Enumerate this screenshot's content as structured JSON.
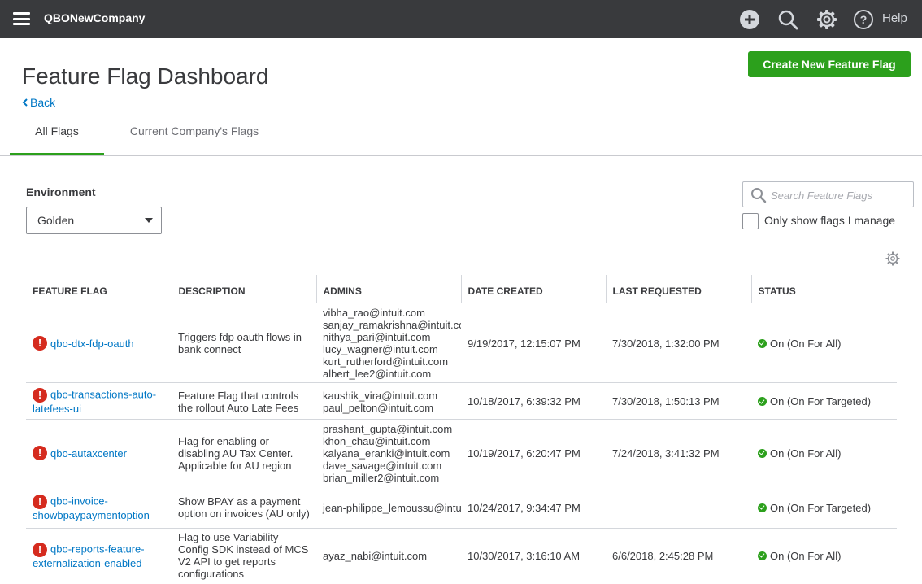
{
  "topbar": {
    "company_name": "QBONewCompany",
    "help_label": "Help",
    "icons": [
      "menu-icon",
      "plus-icon",
      "search-icon",
      "gear-icon",
      "help-icon"
    ]
  },
  "page": {
    "title": "Feature Flag Dashboard",
    "back_label": "Back",
    "create_button_label": "Create New Feature Flag"
  },
  "tabs": [
    {
      "label": "All Flags",
      "active": true
    },
    {
      "label": "Current Company's Flags",
      "active": false
    }
  ],
  "filters": {
    "environment_label": "Environment",
    "environment_value": "Golden",
    "search_placeholder": "Search Feature Flags",
    "manage_checkbox_label": "Only show flags I manage",
    "manage_checked": false
  },
  "table": {
    "headers": [
      "FEATURE FLAG",
      "DESCRIPTION",
      "ADMINS",
      "DATE CREATED",
      "LAST REQUESTED",
      "STATUS"
    ],
    "rows": [
      {
        "flag_line1": "qbo-dtx-fdp-oauth",
        "flag_line2": "",
        "description": "Triggers fdp oauth flows in bank connect",
        "admins": [
          "vibha_rao@intuit.com",
          "sanjay_ramakrishna@intuit.com",
          "nithya_pari@intuit.com",
          "lucy_wagner@intuit.com",
          "kurt_rutherford@intuit.com",
          "albert_lee2@intuit.com"
        ],
        "date_created": "9/19/2017, 12:15:07 PM",
        "last_requested": "7/30/2018, 1:32:00 PM",
        "status": "On (On For All)"
      },
      {
        "flag_line1": "qbo-transactions-auto-",
        "flag_line2": "latefees-ui",
        "description": "Feature Flag that controls the rollout Auto Late Fees",
        "admins": [
          "kaushik_vira@intuit.com",
          "paul_pelton@intuit.com"
        ],
        "date_created": "10/18/2017, 6:39:32 PM",
        "last_requested": "7/30/2018, 1:50:13 PM",
        "status": "On (On For Targeted)"
      },
      {
        "flag_line1": "qbo-autaxcenter",
        "flag_line2": "",
        "description": "Flag for enabling or disabling AU Tax Center. Applicable for AU region",
        "admins": [
          "prashant_gupta@intuit.com",
          "khon_chau@intuit.com",
          "kalyana_eranki@intuit.com",
          "dave_savage@intuit.com",
          "brian_miller2@intuit.com"
        ],
        "date_created": "10/19/2017, 6:20:47 PM",
        "last_requested": "7/24/2018, 3:41:32 PM",
        "status": "On (On For All)"
      },
      {
        "flag_line1": "qbo-invoice-",
        "flag_line2": "showbpaypaymentoption",
        "description": "Show BPAY as a payment option on invoices (AU only)",
        "admins": [
          "jean-philippe_lemoussu@intuit.com"
        ],
        "date_created": "10/24/2017, 9:34:47 PM",
        "last_requested": "",
        "status": "On (On For Targeted)"
      },
      {
        "flag_line1": "qbo-reports-feature-",
        "flag_line2": "externalization-enabled",
        "description": "Flag to use Variability Config SDK instead of MCS V2 API to get reports configurations",
        "admins": [
          "ayaz_nabi@intuit.com"
        ],
        "date_created": "10/30/2017, 3:16:10 AM",
        "last_requested": "6/6/2018, 2:45:28 PM",
        "status": "On (On For All)"
      }
    ]
  },
  "colors": {
    "topbar_bg": "#393a3d",
    "accent_green": "#2ca01c",
    "link_blue": "#0077c5",
    "error_red": "#d52b1e"
  }
}
